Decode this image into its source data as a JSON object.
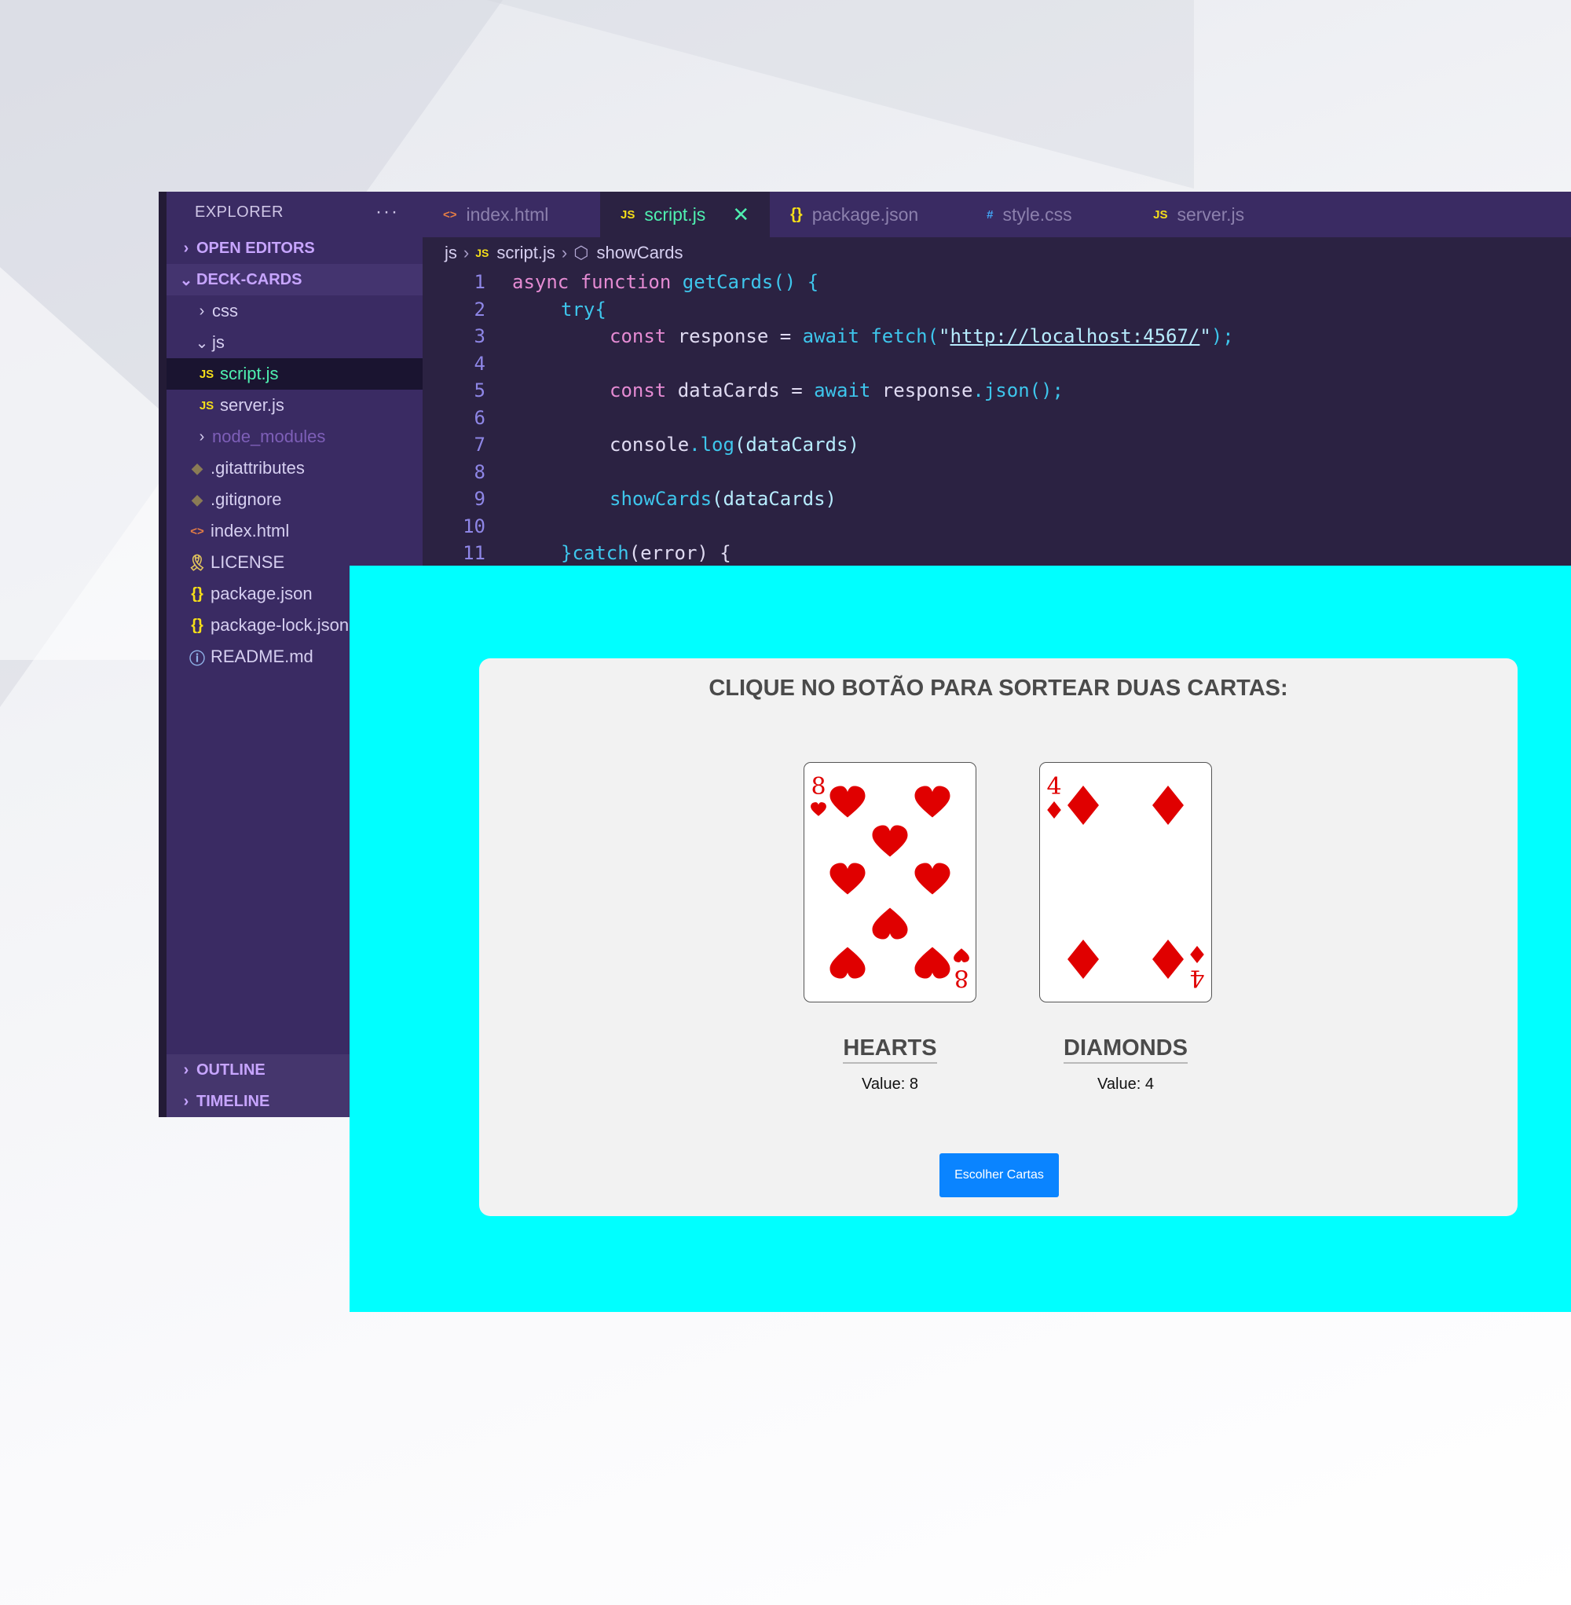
{
  "explorer": {
    "title": "EXPLORER",
    "more": "···",
    "open_editors": "OPEN EDITORS",
    "project": "DECK-CARDS",
    "tree": {
      "css": "css",
      "js": "js",
      "script": "script.js",
      "server": "server.js",
      "node_modules": "node_modules",
      "gitattributes": ".gitattributes",
      "gitignore": ".gitignore",
      "index": "index.html",
      "license": "LICENSE",
      "package": "package.json",
      "package_lock": "package-lock.json",
      "readme": "README.md"
    },
    "outline": "OUTLINE",
    "timeline": "TIMELINE"
  },
  "tabs": {
    "index": "index.html",
    "script": "script.js",
    "package": "package.json",
    "style": "style.css",
    "server": "server.js",
    "close": "✕"
  },
  "breadcrumb": {
    "folder": "js",
    "file": "script.js",
    "symbol": "showCards"
  },
  "code": {
    "line_numbers": [
      "1",
      "2",
      "3",
      "4",
      "5",
      "6",
      "7",
      "8",
      "9",
      "10",
      "11"
    ],
    "l1_kw": "async function ",
    "l1_fn": "getCards",
    "l1_rest": "() {",
    "l2_kw": "try",
    "l2_rest": "{",
    "l3_kw": "const",
    "l3_var": " response = ",
    "l3_kw2": "await",
    "l3_fn": " fetch",
    "l3_open": "(",
    "l3_q1": "\"",
    "l3_url": "http://localhost:4567/",
    "l3_q2": "\"",
    "l3_close": ");",
    "l5_kw": "const",
    "l5_var": " dataCards = ",
    "l5_kw2": "await",
    "l5_obj": " response",
    "l5_fn": ".json",
    "l5_close": "();",
    "l7_obj": "console",
    "l7_fn": ".log",
    "l7_args": "(dataCards)",
    "l9_fn": "showCards",
    "l9_args": "(dataCards)",
    "l11_close": "}",
    "l11_fn": "catch",
    "l11_args": "(error) {"
  },
  "app": {
    "title": "CLIQUE NO BOTÃO PARA SORTEAR DUAS CARTAS:",
    "cards": [
      {
        "rank": "8",
        "suit": "HEARTS",
        "value": "Value: 8",
        "suit_icon": "heart-icon",
        "color": "#e00000"
      },
      {
        "rank": "4",
        "suit": "DIAMONDS",
        "value": "Value: 4",
        "suit_icon": "diamond-icon",
        "color": "#e00000"
      }
    ],
    "button": "Escolher Cartas",
    "background": "#00ffff",
    "button_color": "#0a84ff"
  }
}
